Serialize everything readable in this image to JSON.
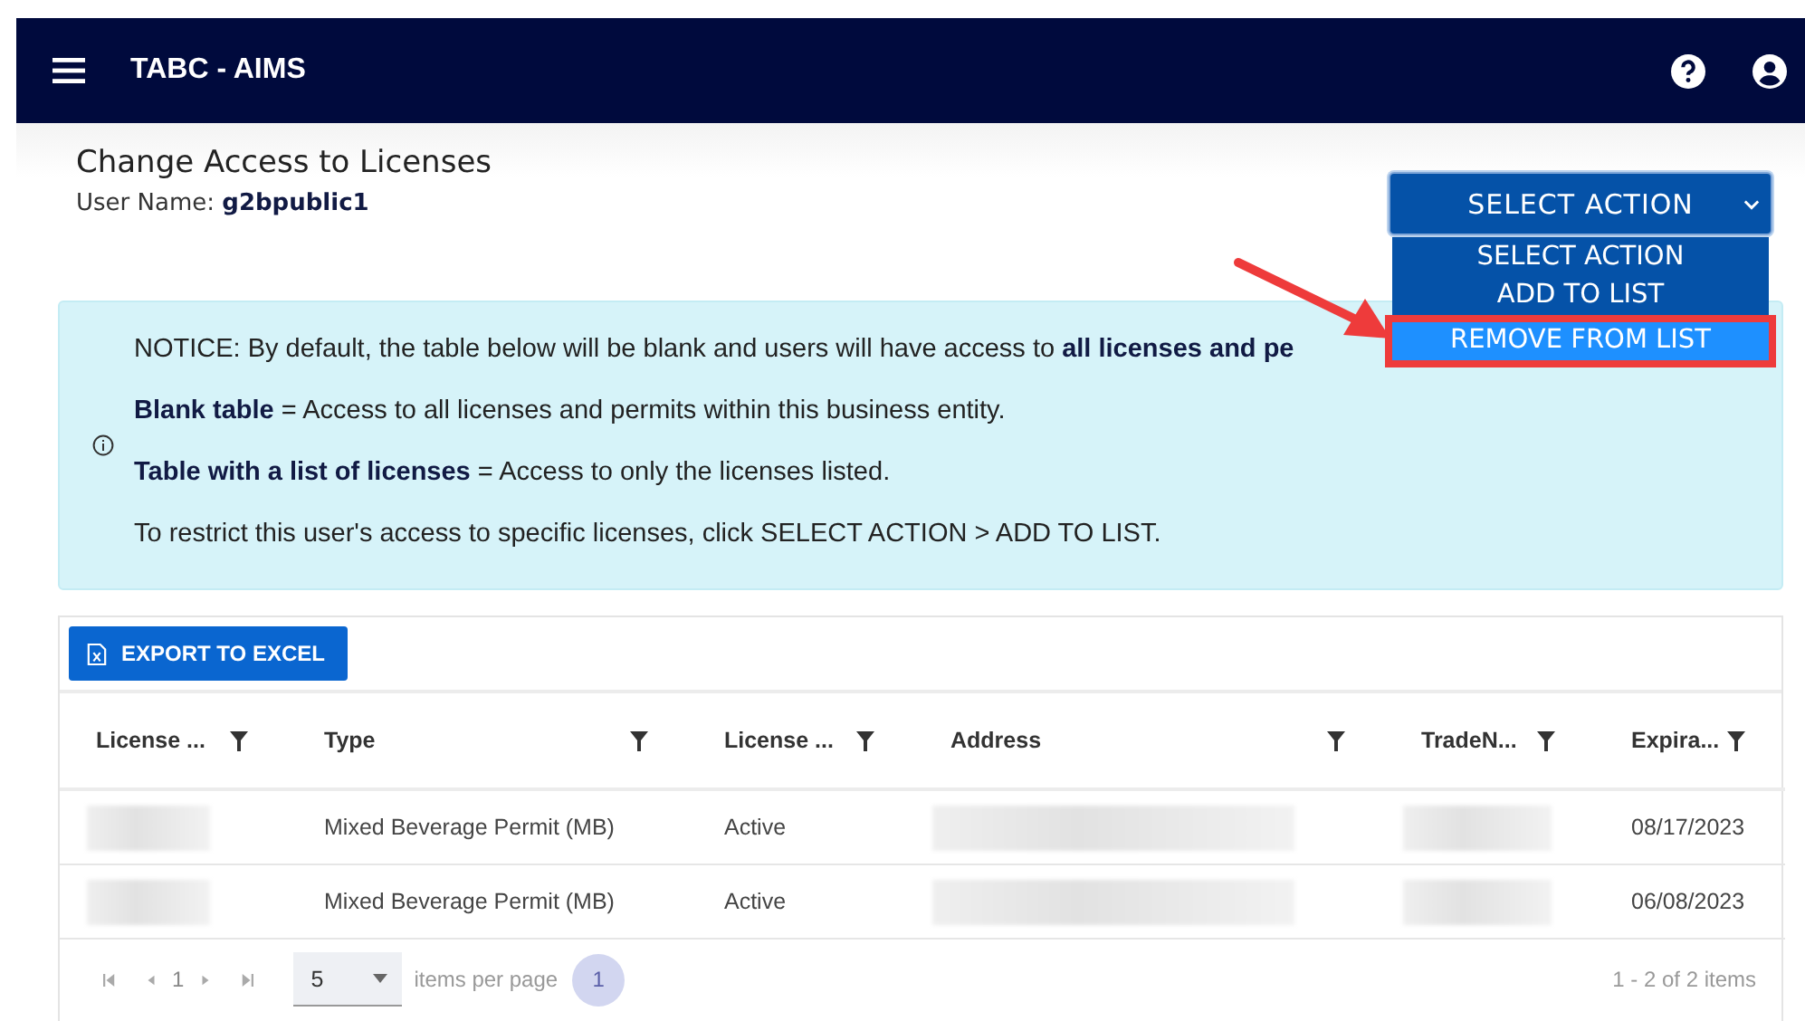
{
  "app_bar": {
    "title": "TABC - AIMS"
  },
  "page": {
    "title": "Change Access to Licenses",
    "user_label": "User Name:",
    "user_name": "g2bpublic1"
  },
  "action_menu": {
    "label": "SELECT ACTION",
    "expanded": true,
    "options": [
      {
        "label": "SELECT ACTION",
        "selected": false,
        "outlined": false
      },
      {
        "label": "ADD TO LIST",
        "selected": false,
        "outlined": false
      },
      {
        "label": "REMOVE FROM LIST",
        "selected": true,
        "outlined": true
      }
    ]
  },
  "notice": {
    "lines": [
      "NOTICE: By default, the table below will be blank and users will have access to **all licenses and pe**",
      "**Blank table** = Access to all licenses and permits within this business entity.",
      "**Table with a list of licenses** = Access to only the licenses listed.",
      "To restrict this user's access to specific licenses, click SELECT ACTION > ADD TO LIST."
    ]
  },
  "toolbar": {
    "export_button": "EXPORT TO EXCEL"
  },
  "table": {
    "columns": [
      "License ...",
      "Type",
      "License ...",
      "Address",
      "TradeN...",
      "Expira..."
    ],
    "rows": [
      [
        {
          "kind": "redacted"
        },
        {
          "kind": "text",
          "text": "Mixed Beverage Permit (MB)"
        },
        {
          "kind": "text",
          "text": "Active"
        },
        {
          "kind": "redacted"
        },
        {
          "kind": "redacted"
        },
        {
          "kind": "text",
          "text": "08/17/2023"
        }
      ],
      [
        {
          "kind": "redacted"
        },
        {
          "kind": "text",
          "text": "Mixed Beverage Permit (MB)"
        },
        {
          "kind": "text",
          "text": "Active"
        },
        {
          "kind": "redacted"
        },
        {
          "kind": "redacted"
        },
        {
          "kind": "text",
          "text": "06/08/2023"
        }
      ]
    ]
  },
  "pager": {
    "current": "1",
    "page_size": "5",
    "page_size_label": "items per page",
    "pages": [
      {
        "label": "1",
        "selected": true
      }
    ],
    "summary": "1 - 2 of 2 items"
  }
}
